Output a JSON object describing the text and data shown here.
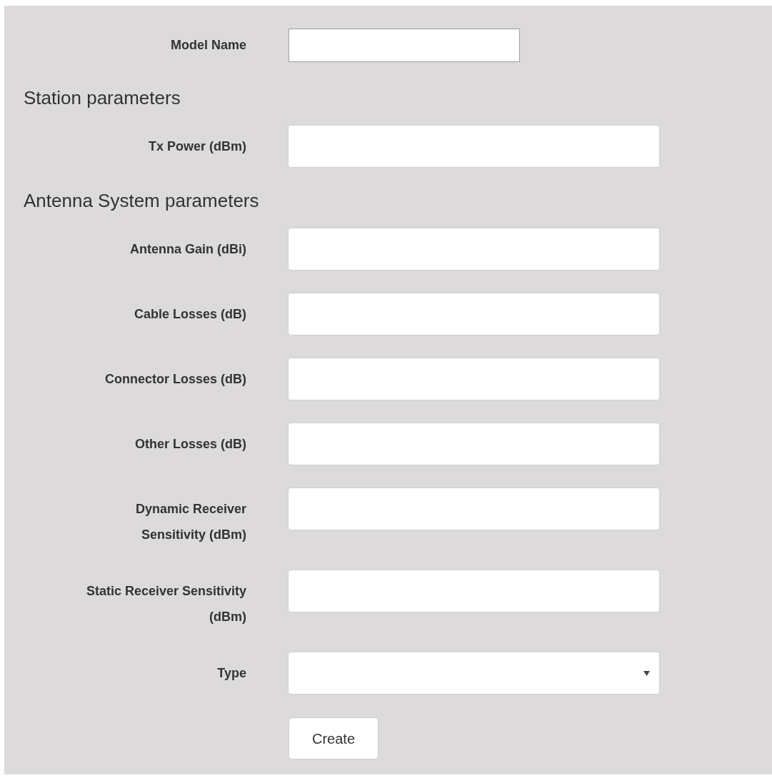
{
  "model_name": {
    "label": "Model Name"
  },
  "sections": [
    {
      "heading": "Station parameters",
      "fields": [
        {
          "label": "Tx Power (dBm)",
          "kind": "text"
        }
      ]
    },
    {
      "heading": "Antenna System parameters",
      "fields": [
        {
          "label": "Antenna Gain (dBi)",
          "kind": "text"
        },
        {
          "label": "Cable Losses (dB)",
          "kind": "text"
        },
        {
          "label": "Connector Losses (dB)",
          "kind": "text"
        },
        {
          "label": "Other Losses (dB)",
          "kind": "text"
        },
        {
          "label": "Dynamic Receiver Sensitivity (dBm)",
          "kind": "text"
        },
        {
          "label": "Static Receiver Sensitivity (dBm)",
          "kind": "text"
        },
        {
          "label": "Type",
          "kind": "select"
        }
      ]
    }
  ],
  "create_button": "Create"
}
